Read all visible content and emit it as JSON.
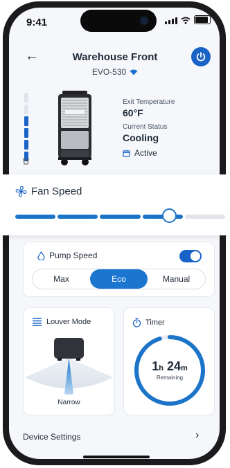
{
  "status_bar": {
    "time": "9:41"
  },
  "header": {
    "title": "Warehouse Front",
    "model": "EVO-530",
    "back_icon": "arrow-left-icon",
    "power_icon": "power-icon"
  },
  "device": {
    "exit_temp_label": "Exit Temperature",
    "exit_temp_value": "60°F",
    "status_label": "Current Status",
    "status_value": "Cooling",
    "schedule_text": "Active",
    "water_level_fraction": 0.67
  },
  "fan": {
    "label": "Fan Speed",
    "level_fraction": 0.8
  },
  "pump": {
    "label": "Pump Speed",
    "enabled": true,
    "options": [
      "Max",
      "Eco",
      "Manual"
    ],
    "selected": "Eco"
  },
  "louver": {
    "label": "Louver Mode",
    "mode": "Narrow"
  },
  "timer": {
    "label": "Timer",
    "hours": "1",
    "hours_unit": "h",
    "minutes": "24",
    "minutes_unit": "m",
    "caption": "Remaining",
    "remaining_fraction": 0.95
  },
  "footer": {
    "settings_label": "Device Settings"
  },
  "colors": {
    "accent": "#1a63c6",
    "inactive": "#e1e5eb",
    "text": "#1f2a37"
  }
}
